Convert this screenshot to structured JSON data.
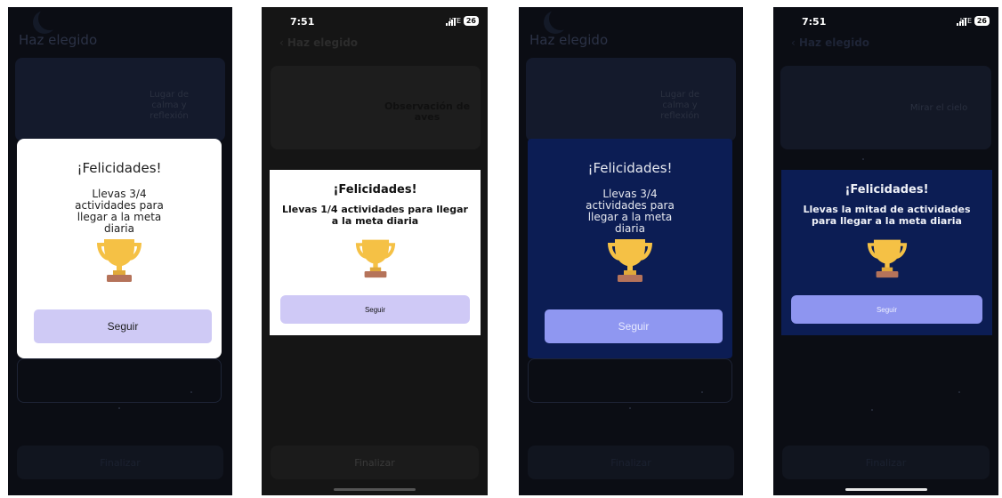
{
  "screens": [
    {
      "background_title": "Haz elegido",
      "bg_card_text": [
        "Lugar de",
        "calma y",
        "reflexión"
      ],
      "bg_bottom_label": "Finalizar",
      "modal": {
        "title": "¡Felicidades!",
        "message": "Llevas 3/4 actividades para llegar a la meta diaria",
        "button_label": "Seguir"
      }
    },
    {
      "status_time": "7:51",
      "status_network": "LTE",
      "status_battery": "26",
      "background_title": "Haz elegido",
      "bg_card_text": "Observación de aves",
      "bg_bottom_label": "Finalizar",
      "modal": {
        "title": "¡Felicidades!",
        "message": "Llevas 1/4 actividades para llegar a la meta diaria",
        "button_label": "Seguir"
      }
    },
    {
      "background_title": "Haz elegido",
      "bg_card_text": [
        "Lugar de",
        "calma y",
        "reflexión"
      ],
      "bg_bottom_label": "Finalizar",
      "modal": {
        "title": "¡Felicidades!",
        "message": "Llevas 3/4 actividades para llegar a la meta diaria",
        "button_label": "Seguir"
      }
    },
    {
      "status_time": "7:51",
      "status_network": "LTE",
      "status_battery": "26",
      "background_title": "Haz elegido",
      "bg_card_text": "Mirar el cielo",
      "bg_bottom_label": "Finalizar",
      "modal": {
        "title": "¡Felicidades!",
        "message": "Llevas la mitad de actividades para llegar a la meta diaria",
        "button_label": "Seguir"
      }
    }
  ],
  "icons": {
    "trophy": "trophy-icon",
    "back": "chevron-left-icon",
    "signal": "signal-bars-icon"
  },
  "colors": {
    "light_modal_bg": "#ffffff",
    "light_button": "#cfcaf5",
    "dark_modal_bg": "#0c1d54",
    "dark_button": "#8f97f1",
    "trophy_gold": "#f5c145",
    "trophy_base": "#b5735a"
  }
}
